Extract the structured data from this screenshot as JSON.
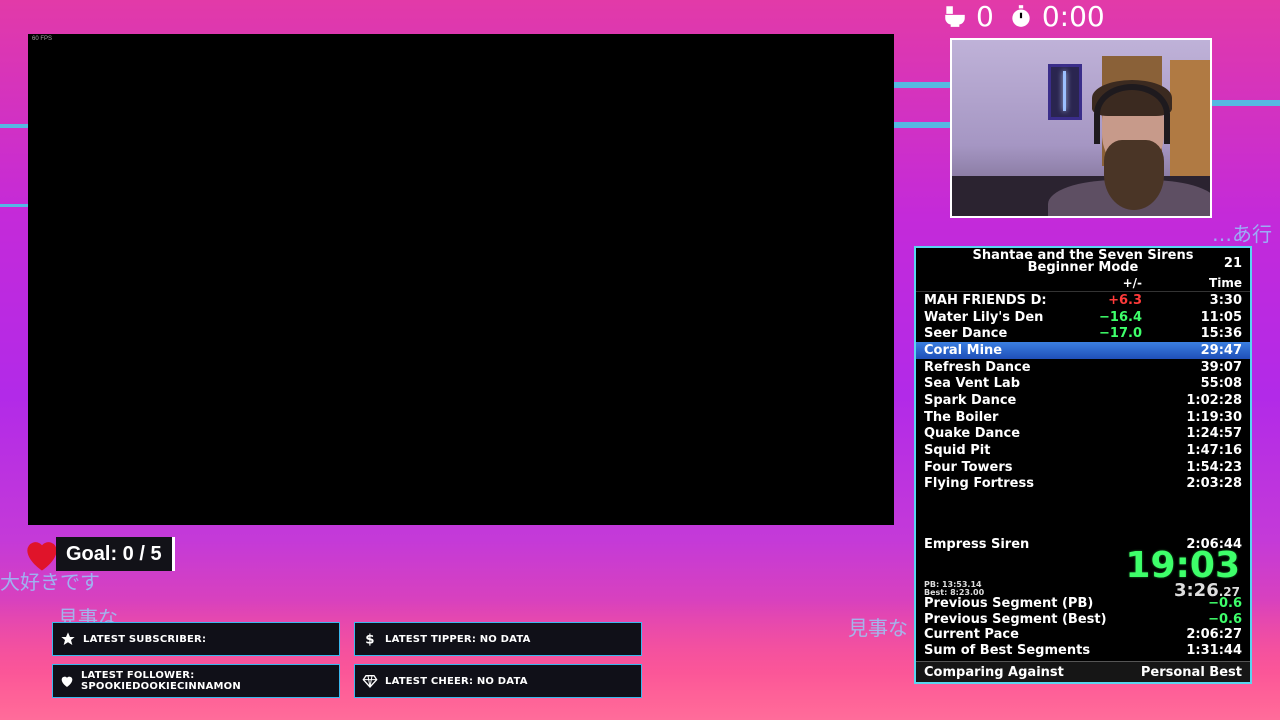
{
  "counters": {
    "deaths": "0",
    "timer": "0:00",
    "deaths_icon": "toilet-icon",
    "timer_icon": "stopwatch-icon"
  },
  "game_capture": {
    "fps_label": "60 FPS"
  },
  "goal": {
    "text": "Goal: 0 / 5"
  },
  "background_text": {
    "jp1": "…あ行こ",
    "jp2": "大好きです",
    "jp3": "見事な",
    "jp4": "見事な"
  },
  "alerts": {
    "subscriber": "LATEST SUBSCRIBER:",
    "tipper": "LATEST TIPPER: NO DATA",
    "follower": "LATEST FOLLOWER: SPOOKIEDOOKIECINNAMON",
    "cheer": "LATEST CHEER: NO DATA"
  },
  "splits": {
    "title_line1": "Shantae and the Seven Sirens",
    "title_line2": "Beginner Mode",
    "attempts": "21",
    "col_delta": "+/-",
    "col_time": "Time",
    "rows": [
      {
        "name": "MAH FRIENDS D:",
        "delta": "+6.3",
        "delta_color": "#ff3a3a",
        "time": "3:30"
      },
      {
        "name": "Water Lily's Den",
        "delta": "−16.4",
        "delta_color": "#3eff6a",
        "time": "11:05"
      },
      {
        "name": "Seer Dance",
        "delta": "−17.0",
        "delta_color": "#3eff6a",
        "time": "15:36"
      },
      {
        "name": "Coral Mine",
        "delta": "",
        "delta_color": "#fff",
        "time": "29:47"
      },
      {
        "name": "Refresh Dance",
        "delta": "",
        "delta_color": "#fff",
        "time": "39:07"
      },
      {
        "name": "Sea Vent Lab",
        "delta": "",
        "delta_color": "#fff",
        "time": "55:08"
      },
      {
        "name": "Spark Dance",
        "delta": "",
        "delta_color": "#fff",
        "time": "1:02:28"
      },
      {
        "name": "The Boiler",
        "delta": "",
        "delta_color": "#fff",
        "time": "1:19:30"
      },
      {
        "name": "Quake Dance",
        "delta": "",
        "delta_color": "#fff",
        "time": "1:24:57"
      },
      {
        "name": "Squid Pit",
        "delta": "",
        "delta_color": "#fff",
        "time": "1:47:16"
      },
      {
        "name": "Four Towers",
        "delta": "",
        "delta_color": "#fff",
        "time": "1:54:23"
      },
      {
        "name": "Flying Fortress",
        "delta": "",
        "delta_color": "#fff",
        "time": "2:03:28"
      }
    ],
    "final": {
      "name": "Empress Siren",
      "time": "2:06:44"
    },
    "main_timer": "19:03",
    "segment_timer": "3:26",
    "segment_timer_fraction": ".27",
    "pb_label": "PB: 13:53.14",
    "best_label": "Best: 8:23.00",
    "stats": [
      {
        "label": "Previous Segment (PB)",
        "value": "−0.6",
        "color": "#3eff6a"
      },
      {
        "label": "Previous Segment (Best)",
        "value": "−0.6",
        "color": "#3eff6a"
      },
      {
        "label": "Current Pace",
        "value": "2:06:27",
        "color": "#fff"
      },
      {
        "label": "Sum of Best Segments",
        "value": "1:31:44",
        "color": "#fff"
      }
    ],
    "footer_left": "Comparing Against",
    "footer_right": "Personal Best"
  }
}
